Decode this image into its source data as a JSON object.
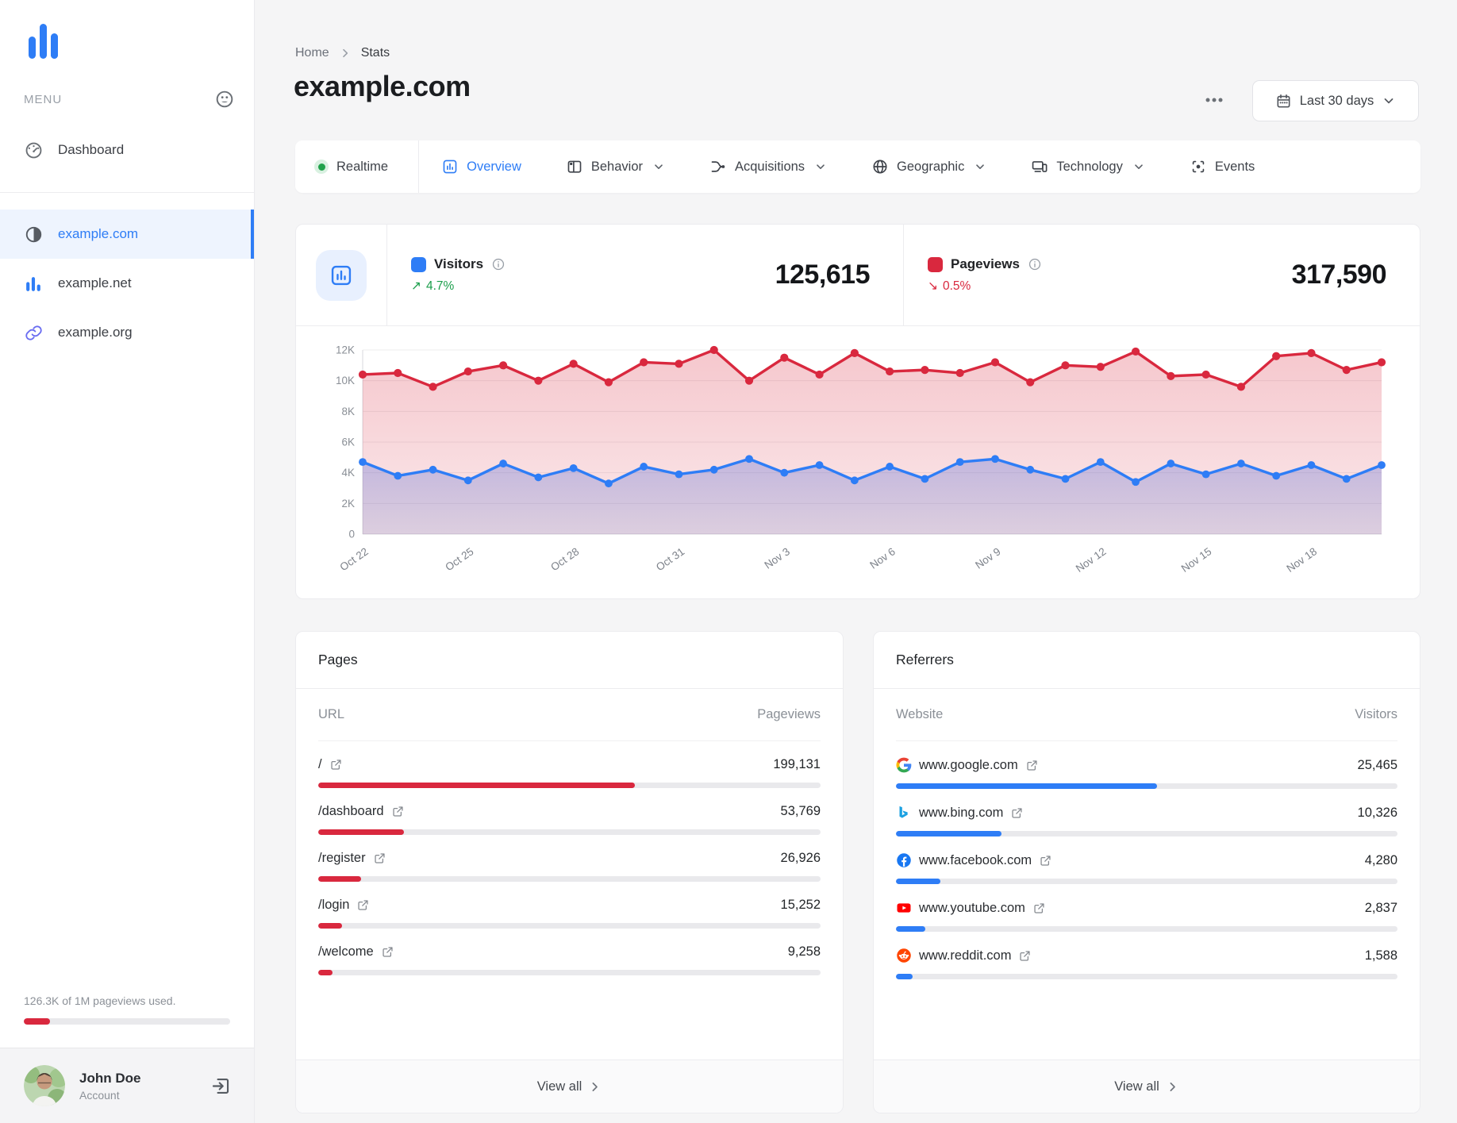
{
  "colors": {
    "blue": "#2e7df6",
    "red": "#d9283e",
    "green": "#1a9e4b",
    "purple": "#6a6df1"
  },
  "sidebar": {
    "menu_label": "MENU",
    "dashboard_label": "Dashboard",
    "sites": [
      {
        "label": "example.com",
        "icon": "contrast",
        "active": true
      },
      {
        "label": "example.net",
        "icon": "chart-small",
        "active": false
      },
      {
        "label": "example.org",
        "icon": "link",
        "active": false
      }
    ],
    "usage_text": "126.3K of 1M pageviews used.",
    "usage_percent": 12.6,
    "account_name": "John Doe",
    "account_role": "Account"
  },
  "header": {
    "breadcrumb_home": "Home",
    "breadcrumb_current": "Stats",
    "title": "example.com",
    "date_range_label": "Last 30 days"
  },
  "tabs": [
    {
      "id": "realtime",
      "label": "Realtime",
      "active": false,
      "dropdown": false
    },
    {
      "id": "overview",
      "label": "Overview",
      "active": true,
      "dropdown": false
    },
    {
      "id": "behavior",
      "label": "Behavior",
      "active": false,
      "dropdown": true
    },
    {
      "id": "acquisitions",
      "label": "Acquisitions",
      "active": false,
      "dropdown": true
    },
    {
      "id": "geographic",
      "label": "Geographic",
      "active": false,
      "dropdown": true
    },
    {
      "id": "technology",
      "label": "Technology",
      "active": false,
      "dropdown": true
    },
    {
      "id": "events",
      "label": "Events",
      "active": false,
      "dropdown": false
    }
  ],
  "summary": {
    "visitors_label": "Visitors",
    "visitors_value": "125,615",
    "visitors_delta": "4.7%",
    "visitors_direction": "up",
    "pageviews_label": "Pageviews",
    "pageviews_value": "317,590",
    "pageviews_delta": "0.5%",
    "pageviews_direction": "down"
  },
  "chart_data": {
    "type": "line",
    "x": [
      "Oct 22",
      "Oct 23",
      "Oct 24",
      "Oct 25",
      "Oct 26",
      "Oct 27",
      "Oct 28",
      "Oct 29",
      "Oct 30",
      "Oct 31",
      "Nov 1",
      "Nov 2",
      "Nov 3",
      "Nov 4",
      "Nov 5",
      "Nov 6",
      "Nov 7",
      "Nov 8",
      "Nov 9",
      "Nov 10",
      "Nov 11",
      "Nov 12",
      "Nov 13",
      "Nov 14",
      "Nov 15",
      "Nov 16",
      "Nov 17",
      "Nov 18",
      "Nov 19",
      "Nov 20"
    ],
    "x_tick_every": 3,
    "series": [
      {
        "name": "Pageviews",
        "color": "#d9283e",
        "values": [
          10400,
          10500,
          9600,
          10600,
          11000,
          10000,
          11100,
          9900,
          11200,
          11100,
          12000,
          10000,
          11500,
          10400,
          11800,
          10600,
          10700,
          10500,
          11200,
          9900,
          11000,
          10900,
          11900,
          10300,
          10400,
          9600,
          11600,
          11800,
          10700,
          11200
        ]
      },
      {
        "name": "Visitors",
        "color": "#2e7df6",
        "values": [
          4700,
          3800,
          4200,
          3500,
          4600,
          3700,
          4300,
          3300,
          4400,
          3900,
          4200,
          4900,
          4000,
          4500,
          3500,
          4400,
          3600,
          4700,
          4900,
          4200,
          3600,
          4700,
          3400,
          4600,
          3900,
          4600,
          3800,
          4500,
          3600,
          4500
        ]
      }
    ],
    "ylim": [
      0,
      12000
    ],
    "yticks": [
      0,
      2000,
      4000,
      6000,
      8000,
      10000,
      12000
    ],
    "ytick_labels": [
      "0",
      "2K",
      "4K",
      "6K",
      "8K",
      "10K",
      "12K"
    ],
    "grid": true,
    "legend_position": "none"
  },
  "pages": {
    "title": "Pages",
    "col_left": "URL",
    "col_right": "Pageviews",
    "footer": "View all",
    "rows": [
      {
        "url": "/",
        "value": "199,131",
        "bar": 63
      },
      {
        "url": "/dashboard",
        "value": "53,769",
        "bar": 17
      },
      {
        "url": "/register",
        "value": "26,926",
        "bar": 8.5
      },
      {
        "url": "/login",
        "value": "15,252",
        "bar": 4.8
      },
      {
        "url": "/welcome",
        "value": "9,258",
        "bar": 2.9
      }
    ]
  },
  "referrers": {
    "title": "Referrers",
    "col_left": "Website",
    "col_right": "Visitors",
    "footer": "View all",
    "rows": [
      {
        "site": "www.google.com",
        "icon": "google",
        "value": "25,465",
        "bar": 52
      },
      {
        "site": "www.bing.com",
        "icon": "bing",
        "value": "10,326",
        "bar": 21
      },
      {
        "site": "www.facebook.com",
        "icon": "facebook",
        "value": "4,280",
        "bar": 8.8
      },
      {
        "site": "www.youtube.com",
        "icon": "youtube",
        "value": "2,837",
        "bar": 5.8
      },
      {
        "site": "www.reddit.com",
        "icon": "reddit",
        "value": "1,588",
        "bar": 3.3
      }
    ]
  }
}
